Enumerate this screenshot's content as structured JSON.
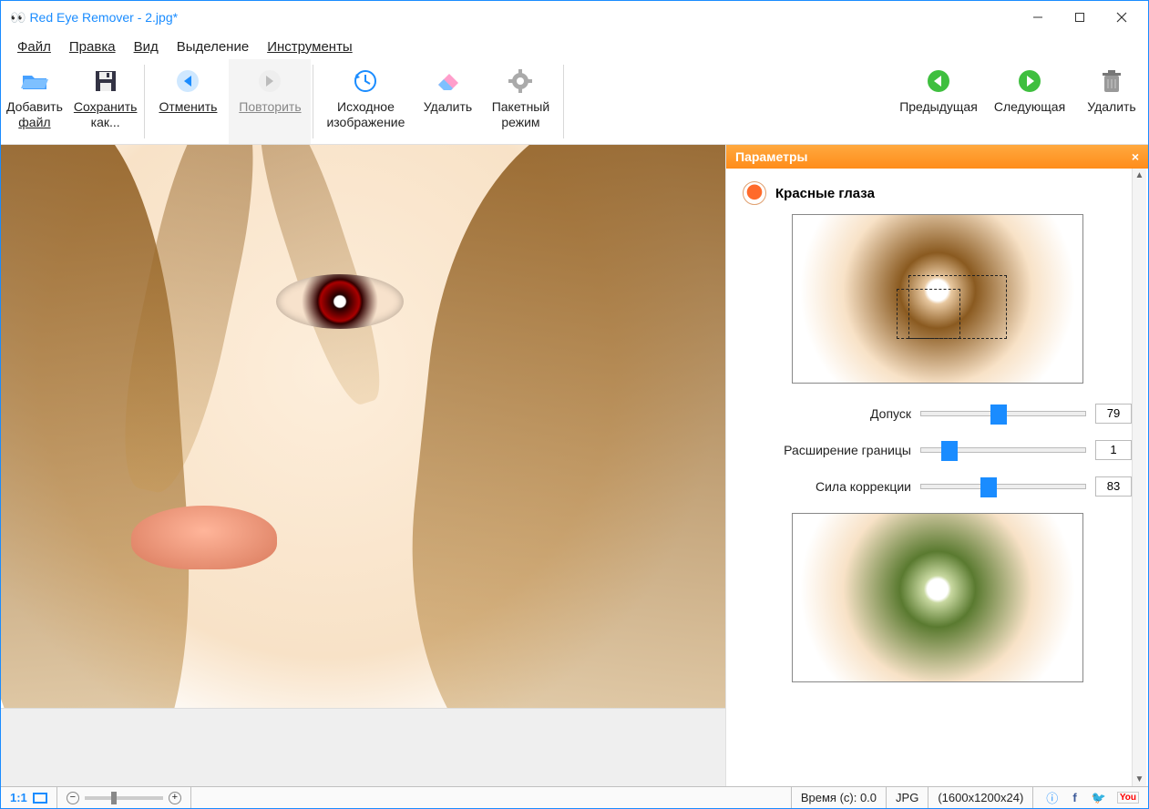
{
  "window": {
    "title": "Red Eye Remover - 2.jpg*"
  },
  "menu": {
    "file": "Файл",
    "edit": "Правка",
    "view": "Вид",
    "selection": "Выделение",
    "tools": "Инструменты"
  },
  "toolbar": {
    "add_file_l1": "Добавить",
    "add_file_l2": "файл",
    "save_as_l1": "Сохранить",
    "save_as_l2": "как...",
    "undo": "Отменить",
    "redo": "Повторить",
    "original_l1": "Исходное",
    "original_l2": "изображение",
    "delete": "Удалить",
    "batch_l1": "Пакетный",
    "batch_l2": "режим",
    "prev": "Предыдущая",
    "next": "Следующая",
    "remove": "Удалить"
  },
  "panel": {
    "title": "Параметры",
    "section": "Красные глаза",
    "tolerance_label": "Допуск",
    "tolerance_value": "79",
    "border_label": "Расширение границы",
    "border_value": "1",
    "strength_label": "Сила коррекции",
    "strength_value": "83"
  },
  "status": {
    "zoom_ratio": "1:1",
    "time_label": "Время (с): 0.0",
    "format": "JPG",
    "dimensions": "(1600x1200x24)"
  }
}
